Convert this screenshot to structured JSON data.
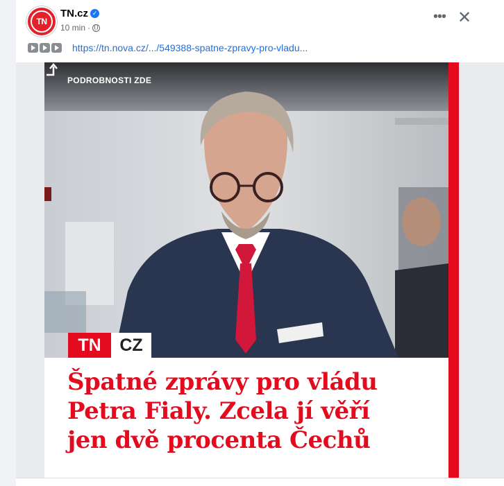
{
  "post": {
    "page_name": "TN.cz",
    "time": "10 min",
    "separator": "·",
    "link_text": "https://tn.nova.cz/.../549388-spatne-zpravy-pro-vladu...",
    "avatar_text": "TN"
  },
  "image": {
    "overlay_text": "PODROBNOSTI ZDE",
    "logo_tn": "TN",
    "logo_cz": "CZ",
    "headline_lines": [
      "Špatné zprávy pro vládu",
      "Petra Fialy. Zcela jí věří",
      "jen dvě procenta Čechů"
    ]
  },
  "icons": {
    "verified": "verified-badge-icon",
    "globe": "globe-icon",
    "more": "more-options-icon",
    "close": "close-icon",
    "play": "play-icon",
    "arrow": "up-right-arrow-icon"
  },
  "colors": {
    "brand_red": "#e40b1e",
    "link_blue": "#216fdb",
    "meta_gray": "#65676b"
  }
}
